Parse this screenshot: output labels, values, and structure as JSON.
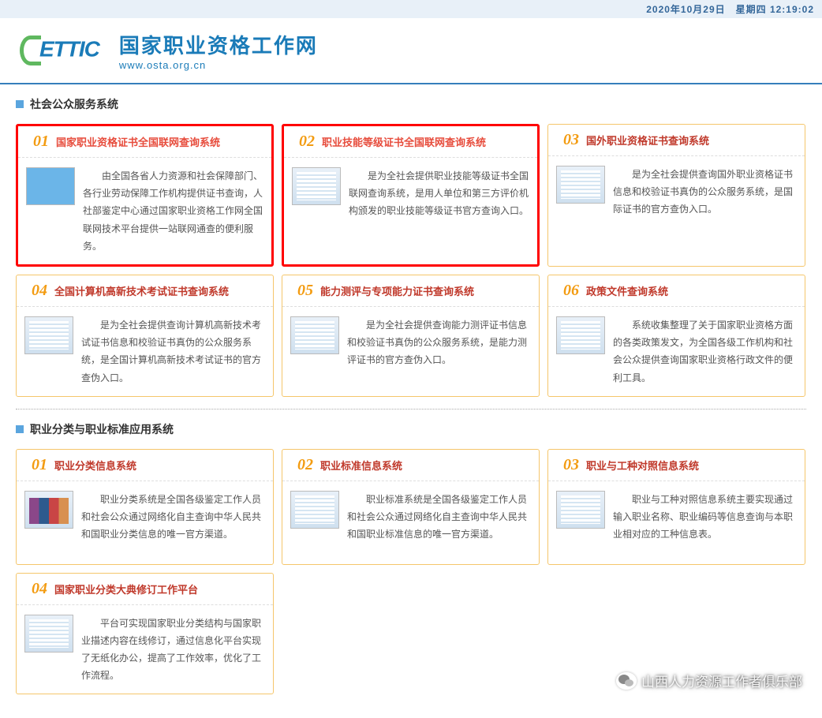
{
  "datetime": "2020年10月29日　星期四 12:19:02",
  "site": {
    "title": "国家职业资格工作网",
    "subtitle": "www.osta.org.cn",
    "logo_text": "ETTIC"
  },
  "section1": {
    "title": "社会公众服务系统",
    "cards": [
      {
        "num": "01",
        "title": "国家职业资格证书全国联网查询系统",
        "desc": "由全国各省人力资源和社会保障部门、各行业劳动保障工作机构提供证书查询，人社部鉴定中心通过国家职业资格工作网全国联网技术平台提供一站联网通查的便利服务。",
        "highlight": true,
        "thumb": "blue-card"
      },
      {
        "num": "02",
        "title": "职业技能等级证书全国联网查询系统",
        "desc": "是为全社会提供职业技能等级证书全国联网查询系统，是用人单位和第三方评价机构颁发的职业技能等级证书官方查询入口。",
        "highlight": true,
        "thumb": ""
      },
      {
        "num": "03",
        "title": "国外职业资格证书查询系统",
        "desc": "是为全社会提供查询国外职业资格证书信息和校验证书真伪的公众服务系统，是国际证书的官方查伪入口。",
        "highlight": false,
        "thumb": ""
      },
      {
        "num": "04",
        "title": "全国计算机高新技术考试证书查询系统",
        "desc": "是为全社会提供查询计算机高新技术考试证书信息和校验证书真伪的公众服务系统，是全国计算机高新技术考试证书的官方查伪入口。",
        "highlight": false,
        "thumb": ""
      },
      {
        "num": "05",
        "title": "能力测评与专项能力证书查询系统",
        "desc": "是为全社会提供查询能力测评证书信息和校验证书真伪的公众服务系统，是能力测评证书的官方查伪入口。",
        "highlight": false,
        "thumb": ""
      },
      {
        "num": "06",
        "title": "政策文件查询系统",
        "desc": "系统收集整理了关于国家职业资格方面的各类政策发文，为全国各级工作机构和社会公众提供查询国家职业资格行政文件的便利工具。",
        "highlight": false,
        "thumb": ""
      }
    ]
  },
  "section2": {
    "title": "职业分类与职业标准应用系统",
    "cards": [
      {
        "num": "01",
        "title": "职业分类信息系统",
        "desc": "职业分类系统是全国各级鉴定工作人员和社会公众通过网络化自主查询中华人民共和国职业分类信息的唯一官方渠道。",
        "thumb": "books"
      },
      {
        "num": "02",
        "title": "职业标准信息系统",
        "desc": "职业标准系统是全国各级鉴定工作人员和社会公众通过网络化自主查询中华人民共和国职业标准信息的唯一官方渠道。",
        "thumb": ""
      },
      {
        "num": "03",
        "title": "职业与工种对照信息系统",
        "desc": "职业与工种对照信息系统主要实现通过输入职业名称、职业编码等信息查询与本职业相对应的工种信息表。",
        "thumb": ""
      },
      {
        "num": "04",
        "title": "国家职业分类大典修订工作平台",
        "desc": "平台可实现国家职业分类结构与国家职业描述内容在线修订，通过信息化平台实现了无纸化办公，提高了工作效率，优化了工作流程。",
        "thumb": ""
      }
    ]
  },
  "watermark": "山西人力资源工作者俱乐部"
}
